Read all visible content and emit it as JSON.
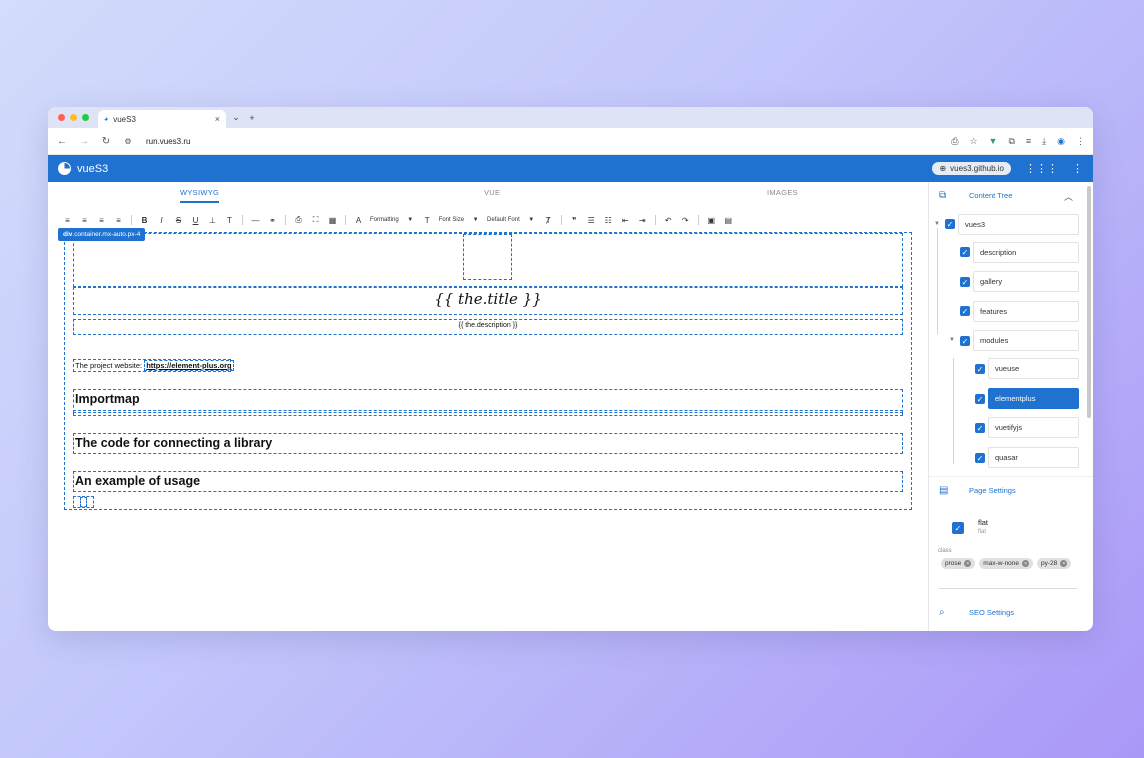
{
  "browser": {
    "tab_title": "vueS3",
    "url": "run.vues3.ru"
  },
  "app": {
    "title": "vueS3",
    "site_pill": "vues3.github.io"
  },
  "editor_tabs": [
    "WYSIWYG",
    "VUE",
    "IMAGES"
  ],
  "toolbar": {
    "formatting_label": "Formatting",
    "font_size_label": "Font Size",
    "font_label": "Default Font"
  },
  "element_path": {
    "tag": "div",
    "classes": ".container.mx-auto.px-4"
  },
  "content": {
    "title": "{{ the.title }}",
    "description": "{{ the.description }}",
    "website_prefix": "The project website:",
    "website_link": "https://element-plus.org",
    "heading1": "Importmap",
    "heading2": "The code for connecting a library",
    "heading3": "An example of usage"
  },
  "side": {
    "content_tree_label": "Content Tree",
    "tree": [
      "vues3",
      "description",
      "gallery",
      "features",
      "modules",
      "vueuse",
      "elementplus",
      "vuetifyjs",
      "quasar"
    ],
    "page_settings_label": "Page Settings",
    "flat_label": "flat",
    "flat_sub": "flat",
    "class_label": "class",
    "class_tags": [
      "prose",
      "max-w-none",
      "py-28"
    ],
    "seo_settings_label": "SEO Settings"
  },
  "colors": {
    "primary": "#1f72cf",
    "fab": "#9c27b0"
  },
  "fab_label": "+"
}
